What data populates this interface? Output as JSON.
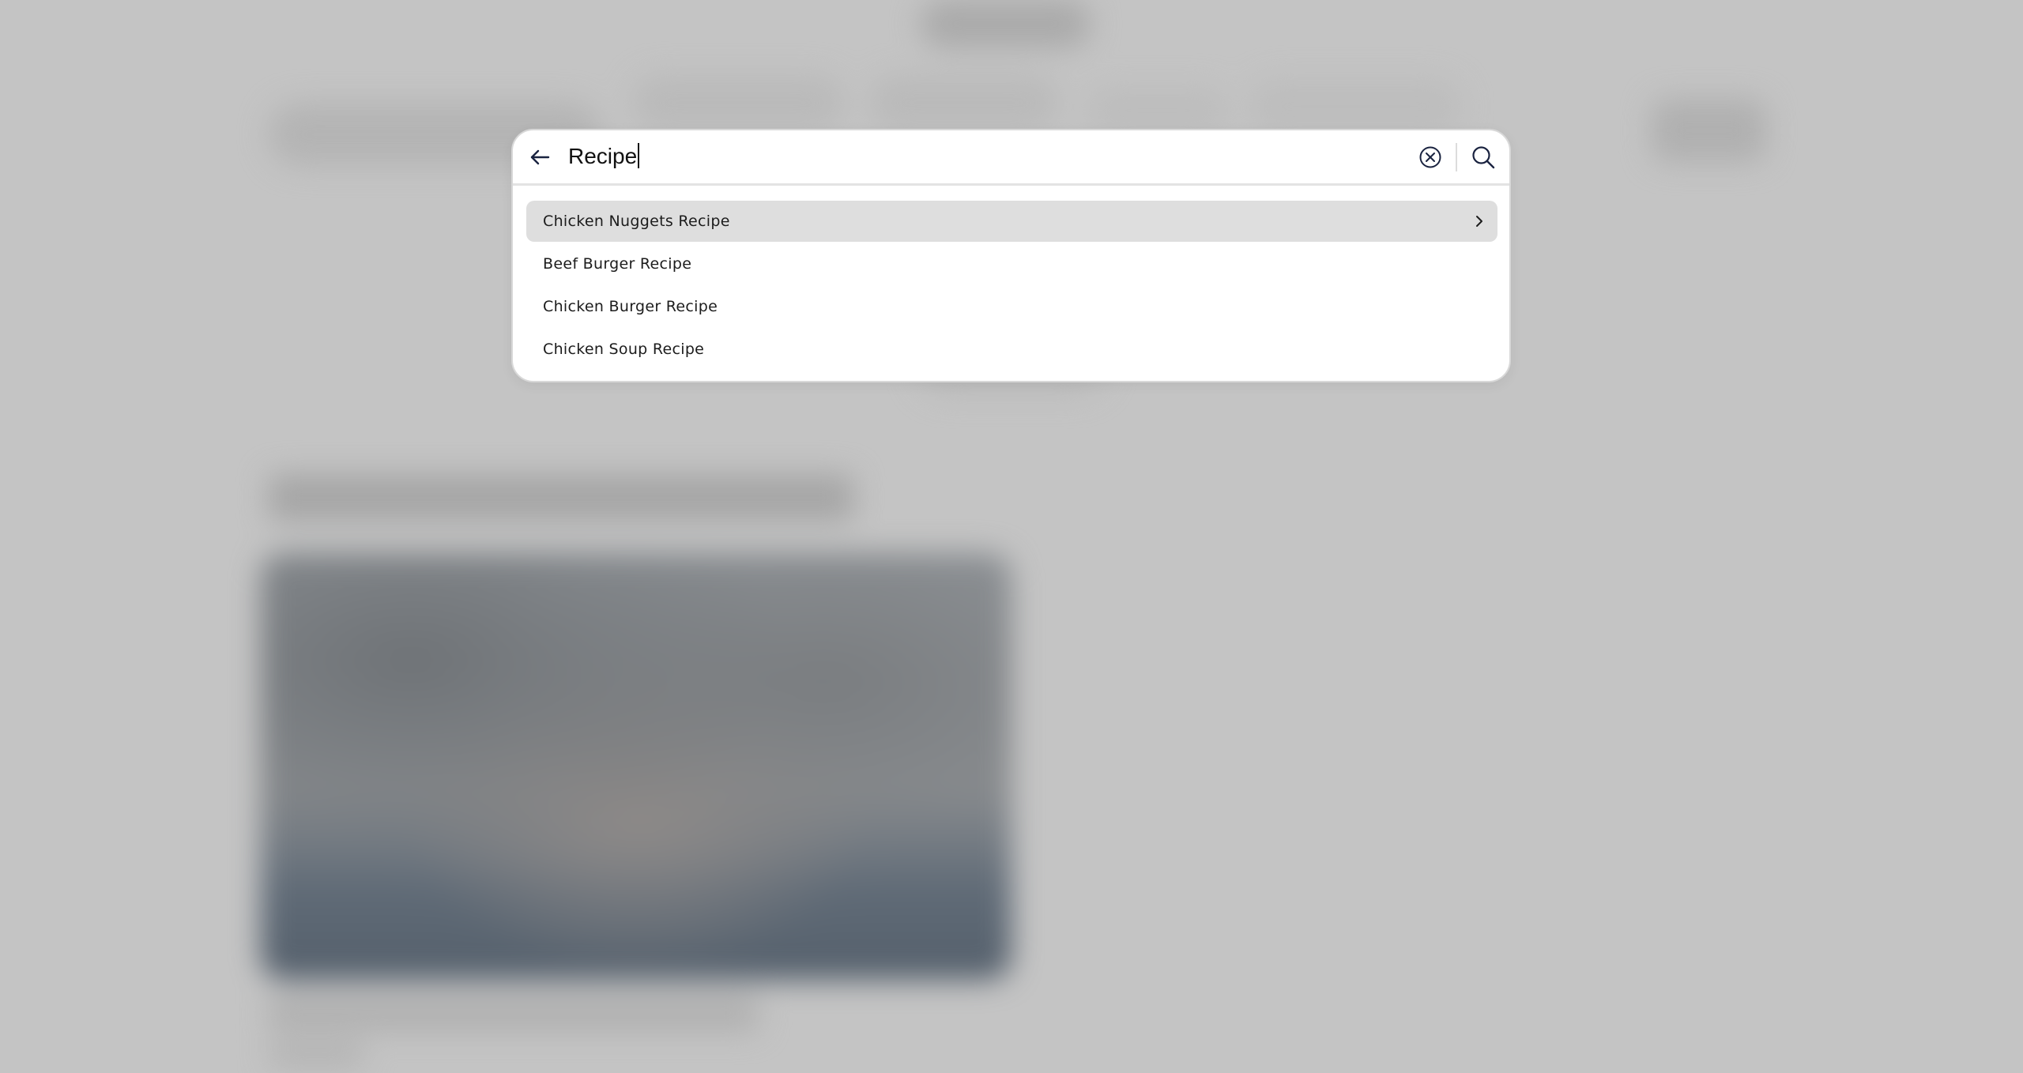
{
  "search": {
    "query": "Recipe",
    "placeholder": ""
  },
  "suggestions": [
    {
      "label": "Chicken Nuggets Recipe",
      "highlighted": true
    },
    {
      "label": "Beef Burger Recipe",
      "highlighted": false
    },
    {
      "label": "Chicken Burger Recipe",
      "highlighted": false
    },
    {
      "label": "Chicken Soup Recipe",
      "highlighted": false
    }
  ],
  "icons": {
    "back": "arrow-left-icon",
    "clear": "clear-circle-x-icon",
    "submit": "magnifier-search-icon",
    "highlighted_suggestion": "chevron-right-icon"
  },
  "colors": {
    "overlay": "#c4c4c4",
    "modal_background": "#ffffff",
    "highlight": "#dedede",
    "icon": "#1a2340",
    "text": "#1c1c1c"
  }
}
